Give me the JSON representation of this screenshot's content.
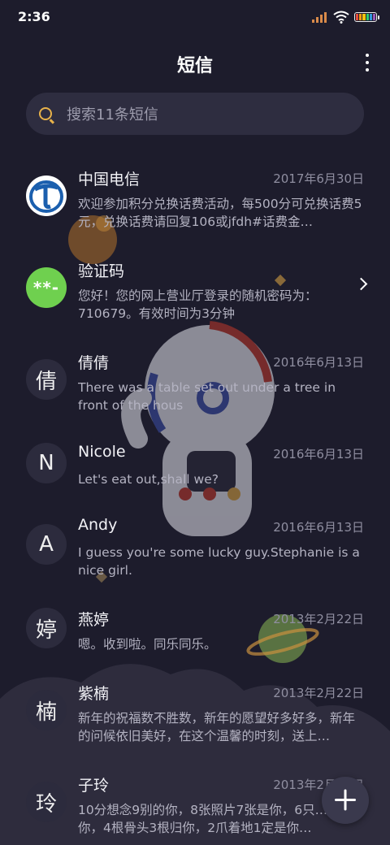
{
  "status": {
    "time": "2:36"
  },
  "header": {
    "title": "短信",
    "more_icon": "more-vertical-icon"
  },
  "search": {
    "placeholder": "搜索11条短信",
    "icon": "search-icon"
  },
  "threads": [
    {
      "sender": "中国电信",
      "date": "2017年6月30日",
      "preview": "欢迎参加积分兑换话费活动，每500分可兑换话费5元，兑换话费请回复106或jfdh#话费金…",
      "avatar": ""
    },
    {
      "sender": "验证码",
      "date": "",
      "preview": "您好！您的网上营业厅登录的随机密码为：710679。有效时间为3分钟",
      "avatar": "**-"
    },
    {
      "sender": "倩倩",
      "date": "2016年6月13日",
      "preview": "There was a table set out under a tree in front of the hous",
      "avatar": "倩"
    },
    {
      "sender": "Nicole",
      "date": "2016年6月13日",
      "preview": "Let's eat out,shall we?",
      "avatar": "N"
    },
    {
      "sender": "Andy",
      "date": "2016年6月13日",
      "preview": "I guess you're some lucky guy.Stephanie is a nice girl.",
      "avatar": "A"
    },
    {
      "sender": "燕婷",
      "date": "2013年2月22日",
      "preview": "嗯。收到啦。同乐同乐。",
      "avatar": "婷"
    },
    {
      "sender": "紫楠",
      "date": "2013年2月22日",
      "preview": "新年的祝福数不胜数，新年的愿望好多好多，新年的问候依旧美好，在这个温馨的时刻，送上…",
      "avatar": "楠"
    },
    {
      "sender": "子玲",
      "date": "2013年2月22日",
      "preview": "10分想念9别的你，8张照片7张是你，6只…只像你，4根骨头3根归你，2爪着地1定是你…",
      "avatar": "玲"
    }
  ],
  "fab": {
    "icon": "plus-icon"
  },
  "colors": {
    "background": "#1d1c2c",
    "accent": "#e8b24a",
    "verify_green": "#6fd04f"
  }
}
